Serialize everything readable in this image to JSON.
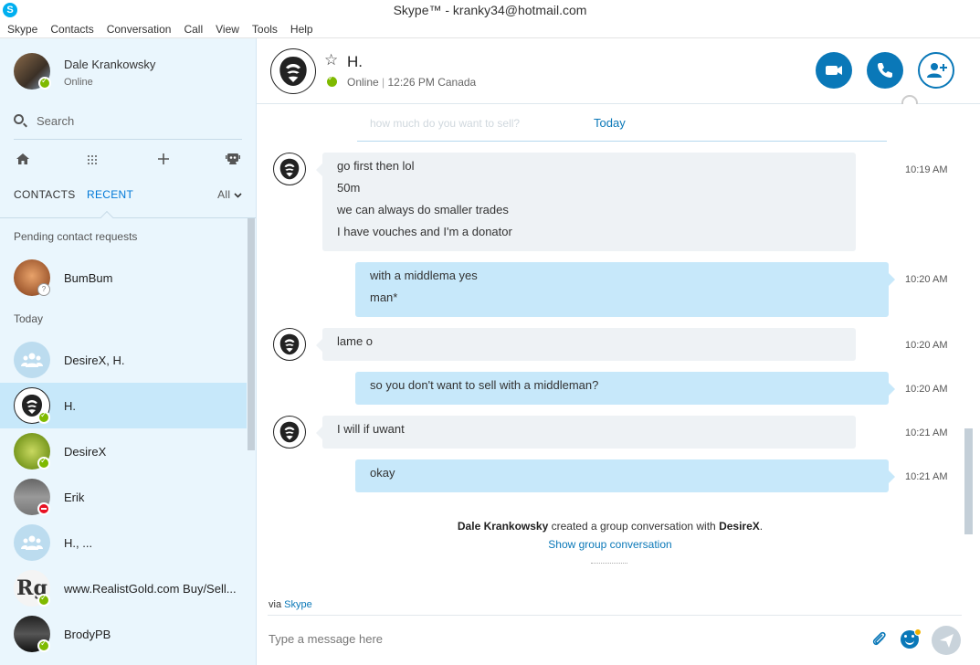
{
  "window": {
    "title": "Skype™ - kranky34@hotmail.com"
  },
  "menu": [
    "Skype",
    "Contacts",
    "Conversation",
    "Call",
    "View",
    "Tools",
    "Help"
  ],
  "me": {
    "name": "Dale Krankowsky",
    "status": "Online"
  },
  "search": {
    "placeholder": "Search"
  },
  "tabs": {
    "contacts": "CONTACTS",
    "recent": "RECENT",
    "filter": "All"
  },
  "sections": {
    "pending": "Pending contact requests",
    "today": "Today"
  },
  "contacts": [
    {
      "name": "BumBum",
      "status": "pending"
    },
    {
      "name": "DesireX, H.",
      "status": "none"
    },
    {
      "name": "H.",
      "status": "online",
      "active": true
    },
    {
      "name": "DesireX",
      "status": "online"
    },
    {
      "name": "Erik",
      "status": "dnd"
    },
    {
      "name": "H., ...",
      "status": "none"
    },
    {
      "name": "www.RealistGold.com Buy/Sell...",
      "status": "online"
    },
    {
      "name": "BrodyPB",
      "status": "online"
    }
  ],
  "conversation": {
    "name": "H.",
    "presence": "Online",
    "local_time": "12:26 PM Canada",
    "day_divider": "Today",
    "faded_preview": "how much do you want to sell?",
    "messages": [
      {
        "direction": "in",
        "lines": [
          "go first then lol",
          "50m",
          "we can always do smaller trades",
          "I have vouches and I'm a donator"
        ],
        "time": "10:19 AM"
      },
      {
        "direction": "out",
        "lines": [
          "with a middlema yes",
          "man*"
        ],
        "time": "10:20 AM"
      },
      {
        "direction": "in",
        "lines": [
          "lame o"
        ],
        "time": "10:20 AM"
      },
      {
        "direction": "out",
        "lines": [
          "so you don't want to sell with a middleman?"
        ],
        "time": "10:20 AM"
      },
      {
        "direction": "in",
        "lines": [
          "I will if uwant"
        ],
        "time": "10:21 AM"
      },
      {
        "direction": "out",
        "lines": [
          "okay"
        ],
        "time": "10:21 AM"
      }
    ],
    "event": {
      "actor": "Dale Krankowsky",
      "text": " created a group conversation with ",
      "target": "DesireX",
      "end": ".",
      "link": "Show group conversation"
    }
  },
  "composer": {
    "via_prefix": "via ",
    "via_link": "Skype",
    "placeholder": "Type a message here"
  },
  "colors": {
    "accent": "#0a78b8",
    "sidebar_bg": "#eaf6fd",
    "bubble_out": "#c7e8fa",
    "bubble_in": "#eef2f5",
    "online": "#7fba00",
    "dnd": "#e81123"
  }
}
